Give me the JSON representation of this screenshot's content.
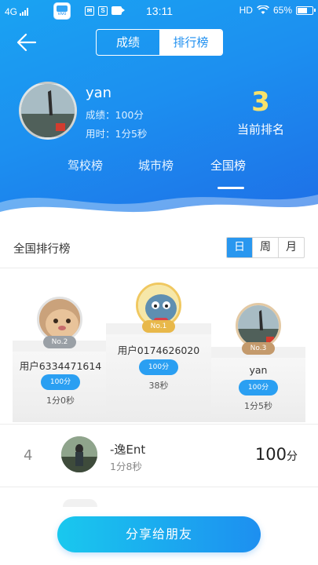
{
  "status_bar": {
    "network": "4G",
    "time": "13:11",
    "hd": "HD",
    "battery": "65%",
    "app_icon_label": "vivo"
  },
  "header": {
    "segments": [
      {
        "label": "成绩",
        "active": false
      },
      {
        "label": "排行榜",
        "active": true
      }
    ],
    "me": {
      "name": "yan",
      "score": "成绩：100分",
      "time": "用时：1分5秒",
      "rank": "3",
      "rank_label": "当前排名"
    },
    "scope_tabs": [
      {
        "label": "驾校榜",
        "active": false
      },
      {
        "label": "城市榜",
        "active": false
      },
      {
        "label": "全国榜",
        "active": true
      }
    ]
  },
  "list": {
    "title": "全国排行榜",
    "periods": [
      {
        "label": "日",
        "active": true
      },
      {
        "label": "周",
        "active": false
      },
      {
        "label": "月",
        "active": false
      }
    ]
  },
  "podium": {
    "first": {
      "badge": "No.1",
      "name": "用户0174626020",
      "score": "100分",
      "time": "38秒"
    },
    "second": {
      "badge": "No.2",
      "name": "用户6334471614",
      "score": "100分",
      "time": "1分0秒"
    },
    "third": {
      "badge": "No.3",
      "name": "yan",
      "score": "100分",
      "time": "1分5秒"
    }
  },
  "rows": [
    {
      "rank": "4",
      "name": "-逸Ent",
      "time": "1分8秒",
      "score": "100",
      "score_unit": "分"
    }
  ],
  "share_button": "分享给朋友",
  "colors": {
    "primary": "#1e8ff0",
    "rank_gold": "#f7e26b",
    "badge_gold": "#e8b84a",
    "badge_gray": "#9aa0a6",
    "badge_bronze": "#c49a6c"
  }
}
